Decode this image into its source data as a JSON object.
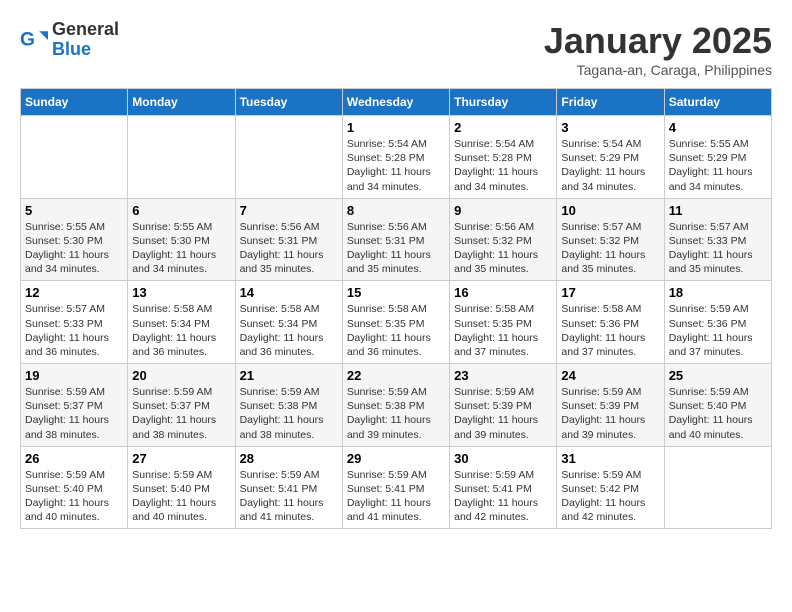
{
  "header": {
    "logo_general": "General",
    "logo_blue": "Blue",
    "month_title": "January 2025",
    "location": "Tagana-an, Caraga, Philippines"
  },
  "weekdays": [
    "Sunday",
    "Monday",
    "Tuesday",
    "Wednesday",
    "Thursday",
    "Friday",
    "Saturday"
  ],
  "weeks": [
    [
      {
        "day": "",
        "content": ""
      },
      {
        "day": "",
        "content": ""
      },
      {
        "day": "",
        "content": ""
      },
      {
        "day": "1",
        "content": "Sunrise: 5:54 AM\nSunset: 5:28 PM\nDaylight: 11 hours\nand 34 minutes."
      },
      {
        "day": "2",
        "content": "Sunrise: 5:54 AM\nSunset: 5:28 PM\nDaylight: 11 hours\nand 34 minutes."
      },
      {
        "day": "3",
        "content": "Sunrise: 5:54 AM\nSunset: 5:29 PM\nDaylight: 11 hours\nand 34 minutes."
      },
      {
        "day": "4",
        "content": "Sunrise: 5:55 AM\nSunset: 5:29 PM\nDaylight: 11 hours\nand 34 minutes."
      }
    ],
    [
      {
        "day": "5",
        "content": "Sunrise: 5:55 AM\nSunset: 5:30 PM\nDaylight: 11 hours\nand 34 minutes."
      },
      {
        "day": "6",
        "content": "Sunrise: 5:55 AM\nSunset: 5:30 PM\nDaylight: 11 hours\nand 34 minutes."
      },
      {
        "day": "7",
        "content": "Sunrise: 5:56 AM\nSunset: 5:31 PM\nDaylight: 11 hours\nand 35 minutes."
      },
      {
        "day": "8",
        "content": "Sunrise: 5:56 AM\nSunset: 5:31 PM\nDaylight: 11 hours\nand 35 minutes."
      },
      {
        "day": "9",
        "content": "Sunrise: 5:56 AM\nSunset: 5:32 PM\nDaylight: 11 hours\nand 35 minutes."
      },
      {
        "day": "10",
        "content": "Sunrise: 5:57 AM\nSunset: 5:32 PM\nDaylight: 11 hours\nand 35 minutes."
      },
      {
        "day": "11",
        "content": "Sunrise: 5:57 AM\nSunset: 5:33 PM\nDaylight: 11 hours\nand 35 minutes."
      }
    ],
    [
      {
        "day": "12",
        "content": "Sunrise: 5:57 AM\nSunset: 5:33 PM\nDaylight: 11 hours\nand 36 minutes."
      },
      {
        "day": "13",
        "content": "Sunrise: 5:58 AM\nSunset: 5:34 PM\nDaylight: 11 hours\nand 36 minutes."
      },
      {
        "day": "14",
        "content": "Sunrise: 5:58 AM\nSunset: 5:34 PM\nDaylight: 11 hours\nand 36 minutes."
      },
      {
        "day": "15",
        "content": "Sunrise: 5:58 AM\nSunset: 5:35 PM\nDaylight: 11 hours\nand 36 minutes."
      },
      {
        "day": "16",
        "content": "Sunrise: 5:58 AM\nSunset: 5:35 PM\nDaylight: 11 hours\nand 37 minutes."
      },
      {
        "day": "17",
        "content": "Sunrise: 5:58 AM\nSunset: 5:36 PM\nDaylight: 11 hours\nand 37 minutes."
      },
      {
        "day": "18",
        "content": "Sunrise: 5:59 AM\nSunset: 5:36 PM\nDaylight: 11 hours\nand 37 minutes."
      }
    ],
    [
      {
        "day": "19",
        "content": "Sunrise: 5:59 AM\nSunset: 5:37 PM\nDaylight: 11 hours\nand 38 minutes."
      },
      {
        "day": "20",
        "content": "Sunrise: 5:59 AM\nSunset: 5:37 PM\nDaylight: 11 hours\nand 38 minutes."
      },
      {
        "day": "21",
        "content": "Sunrise: 5:59 AM\nSunset: 5:38 PM\nDaylight: 11 hours\nand 38 minutes."
      },
      {
        "day": "22",
        "content": "Sunrise: 5:59 AM\nSunset: 5:38 PM\nDaylight: 11 hours\nand 39 minutes."
      },
      {
        "day": "23",
        "content": "Sunrise: 5:59 AM\nSunset: 5:39 PM\nDaylight: 11 hours\nand 39 minutes."
      },
      {
        "day": "24",
        "content": "Sunrise: 5:59 AM\nSunset: 5:39 PM\nDaylight: 11 hours\nand 39 minutes."
      },
      {
        "day": "25",
        "content": "Sunrise: 5:59 AM\nSunset: 5:40 PM\nDaylight: 11 hours\nand 40 minutes."
      }
    ],
    [
      {
        "day": "26",
        "content": "Sunrise: 5:59 AM\nSunset: 5:40 PM\nDaylight: 11 hours\nand 40 minutes."
      },
      {
        "day": "27",
        "content": "Sunrise: 5:59 AM\nSunset: 5:40 PM\nDaylight: 11 hours\nand 40 minutes."
      },
      {
        "day": "28",
        "content": "Sunrise: 5:59 AM\nSunset: 5:41 PM\nDaylight: 11 hours\nand 41 minutes."
      },
      {
        "day": "29",
        "content": "Sunrise: 5:59 AM\nSunset: 5:41 PM\nDaylight: 11 hours\nand 41 minutes."
      },
      {
        "day": "30",
        "content": "Sunrise: 5:59 AM\nSunset: 5:41 PM\nDaylight: 11 hours\nand 42 minutes."
      },
      {
        "day": "31",
        "content": "Sunrise: 5:59 AM\nSunset: 5:42 PM\nDaylight: 11 hours\nand 42 minutes."
      },
      {
        "day": "",
        "content": ""
      }
    ]
  ]
}
